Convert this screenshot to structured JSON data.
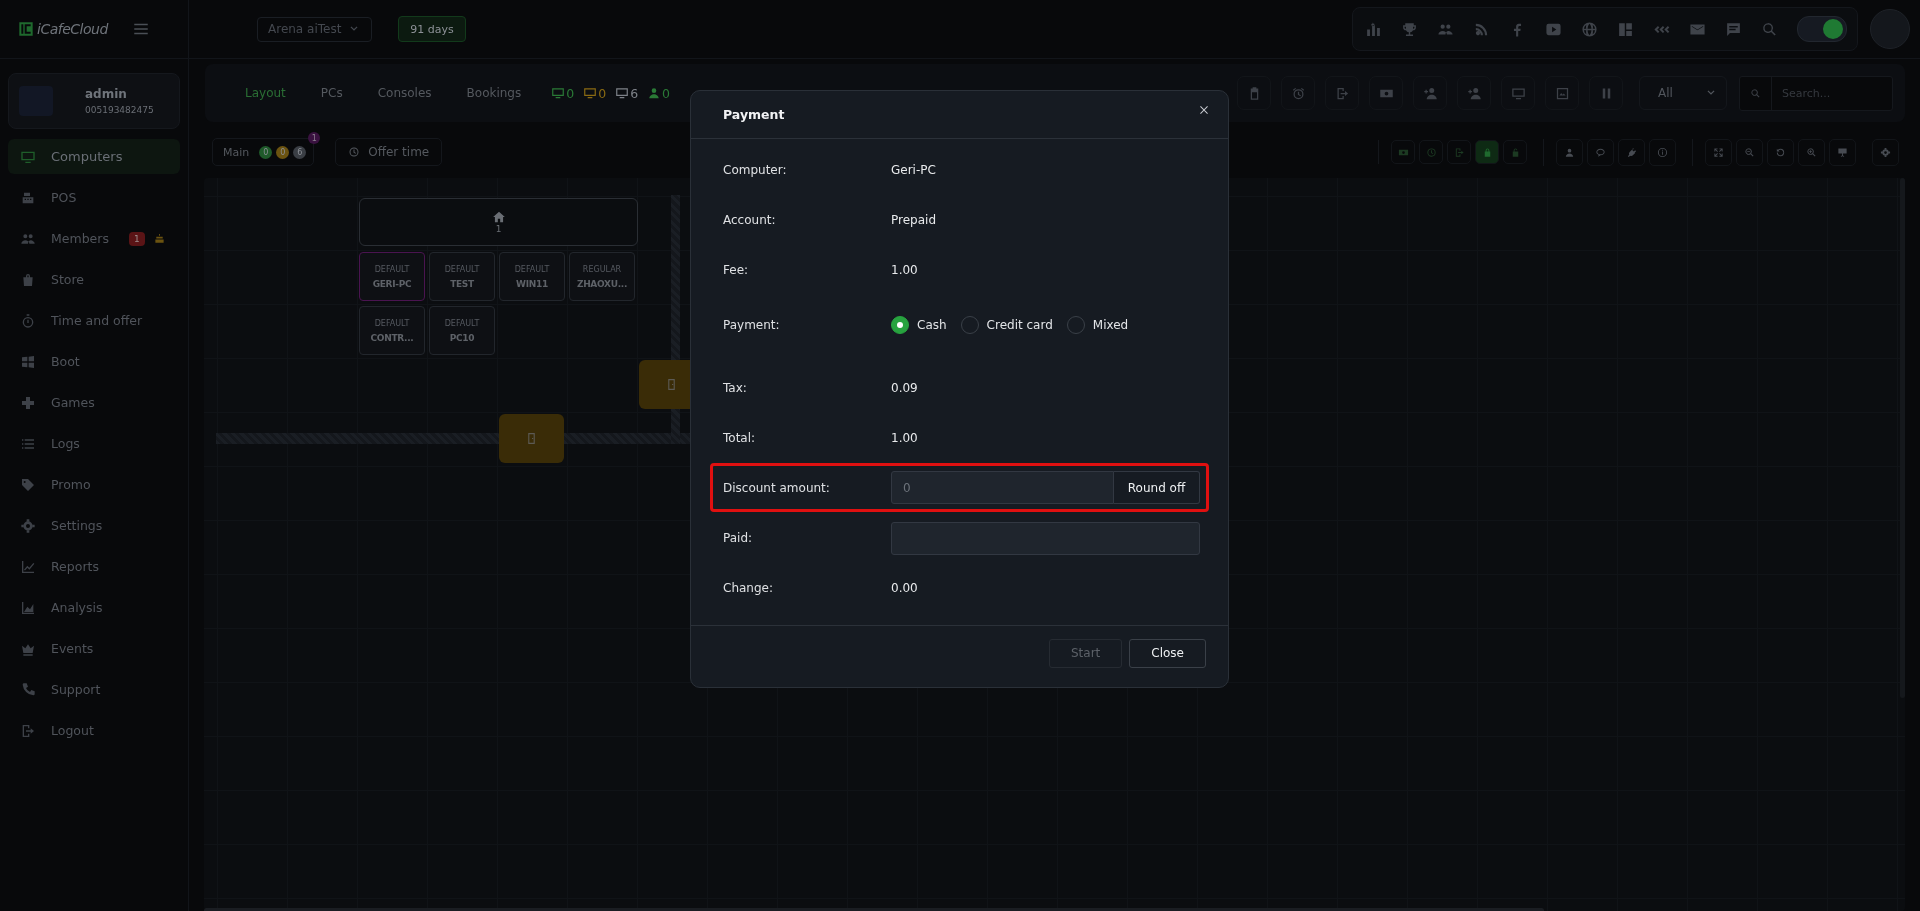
{
  "app": {
    "logo": "iCafeCloud",
    "branch": "Arena aiTest",
    "license": "91 days",
    "theme_toggle": {
      "on": true
    }
  },
  "user": {
    "name": "admin",
    "id": "005193482475"
  },
  "sidebar": {
    "items": [
      {
        "label": "Computers",
        "selected": true
      },
      {
        "label": "POS",
        "selected": false
      },
      {
        "label": "Members",
        "selected": false,
        "badge": "1"
      },
      {
        "label": "Store",
        "selected": false
      },
      {
        "label": "Time and offer",
        "selected": false
      },
      {
        "label": "Boot",
        "selected": false
      },
      {
        "label": "Games",
        "selected": false
      },
      {
        "label": "Logs",
        "selected": false
      },
      {
        "label": "Promo",
        "selected": false
      },
      {
        "label": "Settings",
        "selected": false
      },
      {
        "label": "Reports",
        "selected": false
      },
      {
        "label": "Analysis",
        "selected": false
      },
      {
        "label": "Events",
        "selected": false
      },
      {
        "label": "Support",
        "selected": false
      },
      {
        "label": "Logout",
        "selected": false
      }
    ]
  },
  "toolbar": {
    "tabs": [
      {
        "label": "Layout",
        "selected": true
      },
      {
        "label": "PCs",
        "selected": false
      },
      {
        "label": "Consoles",
        "selected": false
      },
      {
        "label": "Bookings",
        "selected": false
      }
    ],
    "counts": [
      {
        "kind": "monitor",
        "value": "0",
        "color": "#2a7a36"
      },
      {
        "kind": "monitor",
        "value": "0",
        "color": "#8a6a12"
      },
      {
        "kind": "monitor",
        "value": "6",
        "color": "#7d8188"
      },
      {
        "kind": "user",
        "value": "0",
        "color": "#2a7a36"
      }
    ],
    "filter": "All",
    "search_placeholder": "Search..."
  },
  "rooms": {
    "room": {
      "label": "Main",
      "notification": "1",
      "counts": [
        {
          "value": "0",
          "color": "#1f5a2a"
        },
        {
          "value": "0",
          "color": "#6b5310"
        },
        {
          "value": "6",
          "color": "#3a3e44"
        }
      ]
    },
    "offer_time": "Offer time"
  },
  "map": {
    "room_label": "1",
    "pcs": [
      {
        "group": "DEFAULT",
        "name": "GERI-PC",
        "selected": true
      },
      {
        "group": "DEFAULT",
        "name": "TEST",
        "selected": false
      },
      {
        "group": "DEFAULT",
        "name": "WIN11",
        "selected": false
      },
      {
        "group": "REGULAR",
        "name": "ZHAOXU...",
        "selected": false
      },
      {
        "group": "DEFAULT",
        "name": "CONTR...",
        "selected": false
      },
      {
        "group": "DEFAULT",
        "name": "PC10",
        "selected": false
      }
    ]
  },
  "dialog": {
    "title": "Payment",
    "fields": [
      {
        "kind": "text",
        "label": "Computer:",
        "value": "Geri-PC"
      },
      {
        "kind": "text",
        "label": "Account:",
        "value": "Prepaid"
      },
      {
        "kind": "text",
        "label": "Fee:",
        "value": "1.00"
      },
      {
        "kind": "radio",
        "label": "Payment:",
        "options": [
          {
            "label": "Cash",
            "selected": true
          },
          {
            "label": "Credit card",
            "selected": false
          },
          {
            "label": "Mixed",
            "selected": false
          }
        ]
      },
      {
        "kind": "text",
        "label": "Tax:",
        "value": "0.09"
      },
      {
        "kind": "text",
        "label": "Total:",
        "value": "1.00"
      },
      {
        "kind": "input_button",
        "label": "Discount amount:",
        "placeholder": "0",
        "button": "Round off",
        "highlighted": true
      },
      {
        "kind": "input",
        "label": "Paid:"
      },
      {
        "kind": "text",
        "label": "Change:",
        "value": "0.00"
      }
    ],
    "buttons": [
      {
        "label": "Start",
        "disabled": true
      },
      {
        "label": "Close",
        "disabled": false
      }
    ]
  }
}
